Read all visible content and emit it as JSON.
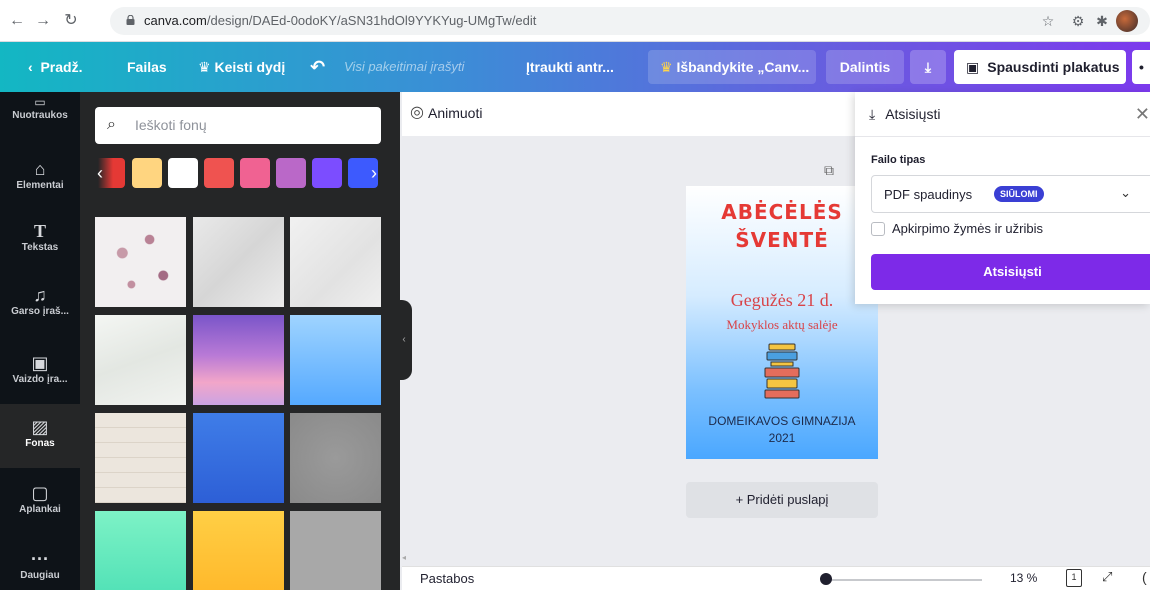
{
  "browser": {
    "url_host": "canva.com",
    "url_path": "/design/DAEd-0odoKY/aSN31hdOl9YYKYug-UMgTw/edit"
  },
  "topbar": {
    "home": "Pradž.",
    "file": "Failas",
    "resize": "Keisti dydį",
    "saved_status": "Visi pakeitimai įrašyti",
    "title": "Įtraukti antr...",
    "try_pro": "Išbandykite „Canv...",
    "share": "Dalintis",
    "print": "Spausdinti plakatus",
    "more": "•"
  },
  "sidebar": {
    "items": [
      {
        "label": "Nuotraukos",
        "icon": "photos-icon"
      },
      {
        "label": "Elementai",
        "icon": "elements-icon"
      },
      {
        "label": "Tekstas",
        "icon": "text-icon"
      },
      {
        "label": "Garso įraš...",
        "icon": "audio-icon"
      },
      {
        "label": "Vaizdo įra...",
        "icon": "video-icon"
      },
      {
        "label": "Fonas",
        "icon": "background-icon"
      },
      {
        "label": "Aplankai",
        "icon": "folder-icon"
      },
      {
        "label": "Daugiau",
        "icon": "more-icon"
      }
    ]
  },
  "panel": {
    "search_placeholder": "Ieškoti fonų",
    "swatches": [
      "#e53935",
      "#ffd580",
      "#ffffff",
      "#ef5350",
      "#f06292",
      "#ba68c8",
      "#7c4dff",
      "#3d5afe"
    ]
  },
  "canvas": {
    "animate": "Animuoti",
    "add_page": "+ Pridėti puslapį"
  },
  "poster": {
    "title_line1": "ABĖCĖLĖS",
    "title_line2": "ŠVENTĖ",
    "date": "Gegužės 21 d.",
    "place": "Mokyklos aktų salėje",
    "school": "DOMEIKAVOS GIMNAZIJA",
    "year": "2021"
  },
  "download_panel": {
    "title": "Atsisiųsti",
    "file_type_label": "Failo tipas",
    "file_type_value": "PDF spaudinys",
    "badge": "SIŪLOMI",
    "checkbox_label": "Apkirpimo žymės ir užribis",
    "button": "Atsisiųsti"
  },
  "bottom": {
    "notes": "Pastabos",
    "zoom": "13 %",
    "page_number": "1"
  },
  "colors": {
    "accent_purple": "#7d2ae8",
    "sidebar_dark": "#0e1318",
    "panel_dark": "#252627"
  }
}
